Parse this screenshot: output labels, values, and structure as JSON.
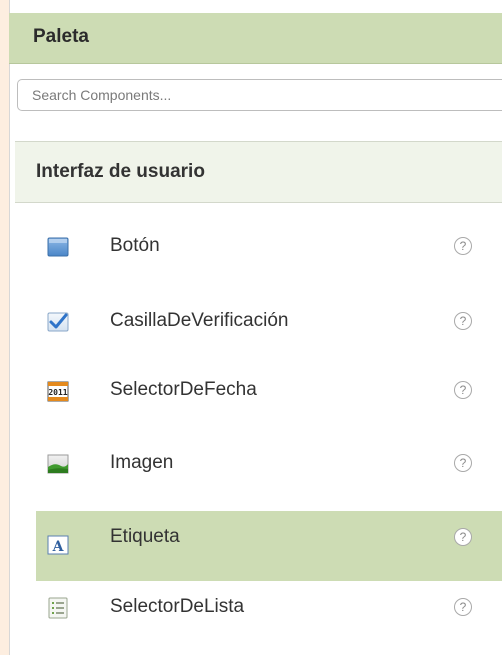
{
  "palette": {
    "title": "Paleta"
  },
  "search": {
    "placeholder": "Search Components..."
  },
  "section": {
    "title": "Interfaz de usuario"
  },
  "items": [
    {
      "label": "Botón",
      "icon": "button-icon",
      "selected": false
    },
    {
      "label": "CasillaDeVerificación",
      "icon": "checkbox-icon",
      "selected": false
    },
    {
      "label": "SelectorDeFecha",
      "icon": "calendar-icon",
      "selected": false
    },
    {
      "label": "Imagen",
      "icon": "image-icon",
      "selected": false
    },
    {
      "label": "Etiqueta",
      "icon": "label-icon",
      "selected": true
    },
    {
      "label": "SelectorDeLista",
      "icon": "list-icon",
      "selected": false
    }
  ],
  "help_symbol": "?",
  "colors": {
    "background": "#fdeee0",
    "header_bg": "#cddcb4",
    "section_bg": "#f0f4ea",
    "selected_bg": "#cddcb4",
    "text": "#333333"
  }
}
